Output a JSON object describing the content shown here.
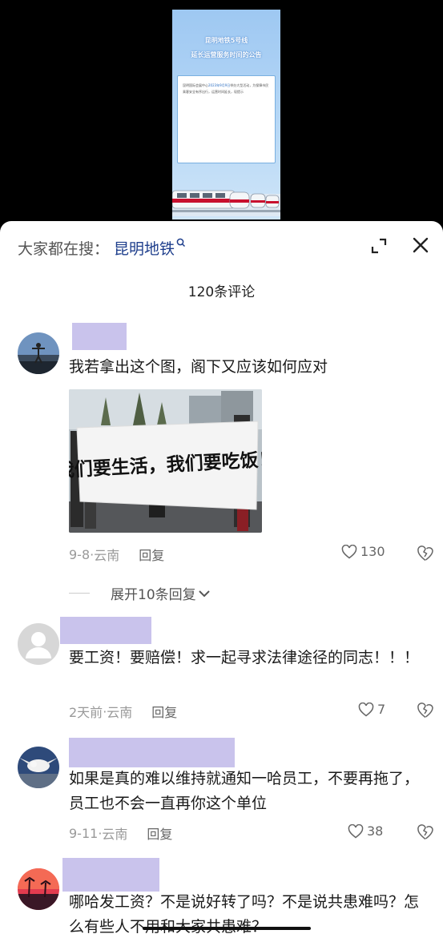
{
  "video": {
    "poster_title_line1": "昆明地铁5号线",
    "poster_title_line2": "延长运营服务时间的公告",
    "poster_body": "昆明国际会展中心2023年9月9日举办大型活动，为保障市民乘客安全有序出行，运营时间延长，现提示",
    "poster_highlight": "2023年9月9日"
  },
  "header": {
    "search_label": "大家都在搜：",
    "search_term": "昆明地铁",
    "comment_count": "120条评论"
  },
  "comments": [
    {
      "text": "我若拿出这个图，阁下又应该如何应对",
      "image_banner_text": "我们要生活，我们要吃饭！",
      "date": "9-8",
      "location": "云南",
      "reply_label": "回复",
      "likes": "130",
      "expand_label": "展开10条回复"
    },
    {
      "text": "要工资！要赔偿！求一起寻求法律途径的同志！！！",
      "date": "2天前",
      "location": "云南",
      "reply_label": "回复",
      "likes": "7"
    },
    {
      "text": "如果是真的难以维持就通知一哈员工，不要再拖了，员工也不会一直再你这个单位",
      "date": "9-11",
      "location": "云南",
      "reply_label": "回复",
      "likes": "38"
    },
    {
      "text": "哪哈发工资？不是说好转了吗？不是说共患难吗？怎么有些人不用和大家共患难？"
    }
  ],
  "colors": {
    "accent": "#1e3e8c",
    "name_redaction": "#c9c3ec",
    "muted": "#999999"
  }
}
